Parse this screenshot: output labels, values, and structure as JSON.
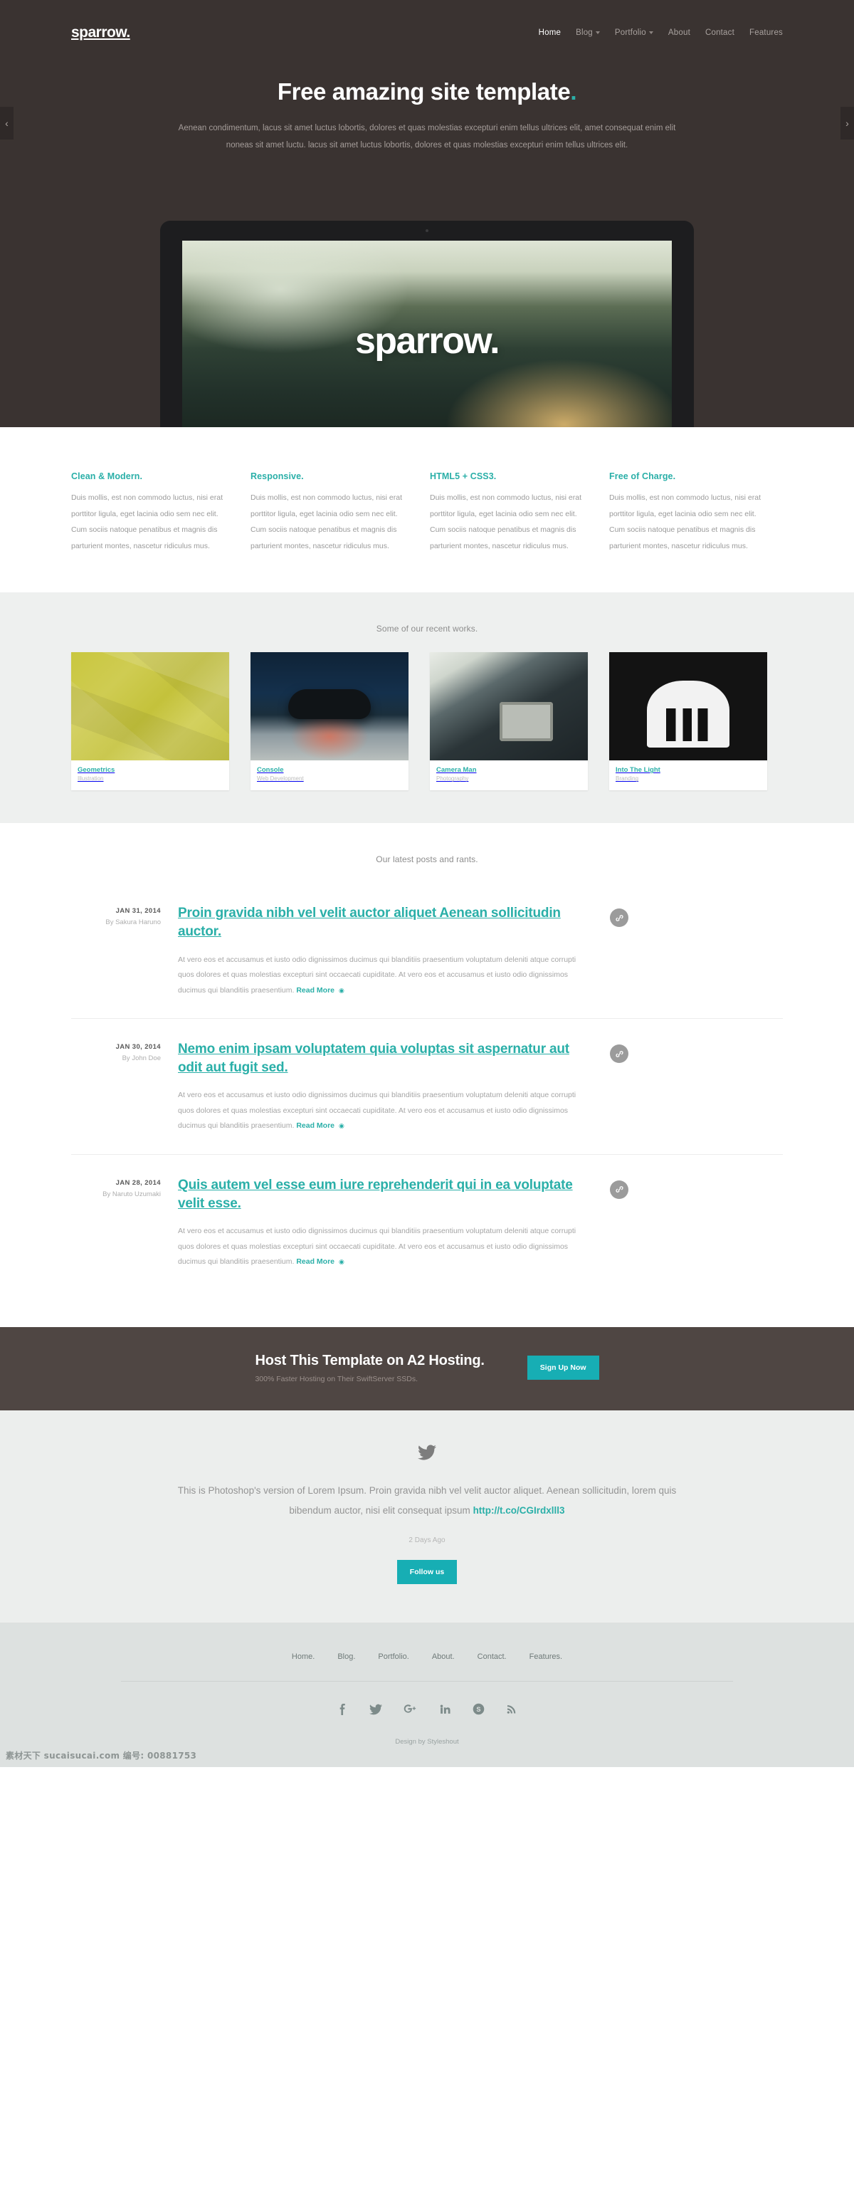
{
  "brand": {
    "logo": "sparrow.",
    "accent": "#2aafa8",
    "dark": "#3a3331",
    "cta_bg": "#4f4643",
    "btn": "#17aeb4"
  },
  "nav": {
    "items": [
      {
        "label": "Home",
        "caret": false,
        "active": true
      },
      {
        "label": "Blog",
        "caret": true,
        "active": false
      },
      {
        "label": "Portfolio",
        "caret": true,
        "active": false
      },
      {
        "label": "About",
        "caret": false,
        "active": false
      },
      {
        "label": "Contact",
        "caret": false,
        "active": false
      },
      {
        "label": "Features",
        "caret": false,
        "active": false
      }
    ]
  },
  "hero": {
    "title": "Free amazing site template",
    "title_dot": ".",
    "subtitle": "Aenean condimentum, lacus sit amet luctus lobortis, dolores et quas molestias excepturi enim tellus ultrices elit, amet consequat enim elit noneas sit amet luctu. lacus sit amet luctus lobortis, dolores et quas molestias excepturi enim tellus ultrices elit.",
    "slider_prev": "‹",
    "slider_next": "›",
    "screen_word": "sparrow."
  },
  "features": [
    {
      "title": "Clean & Modern.",
      "body": "Duis mollis, est non commodo luctus, nisi erat porttitor ligula, eget lacinia odio sem nec elit. Cum sociis natoque penatibus et magnis dis parturient montes, nascetur ridiculus mus."
    },
    {
      "title": "Responsive.",
      "body": "Duis mollis, est non commodo luctus, nisi erat porttitor ligula, eget lacinia odio sem nec elit. Cum sociis natoque penatibus et magnis dis parturient montes, nascetur ridiculus mus."
    },
    {
      "title": "HTML5 + CSS3.",
      "body": "Duis mollis, est non commodo luctus, nisi erat porttitor ligula, eget lacinia odio sem nec elit. Cum sociis natoque penatibus et magnis dis parturient montes, nascetur ridiculus mus."
    },
    {
      "title": "Free of Charge.",
      "body": "Duis mollis, est non commodo luctus, nisi erat porttitor ligula, eget lacinia odio sem nec elit. Cum sociis natoque penatibus et magnis dis parturient montes, nascetur ridiculus mus."
    }
  ],
  "portfolio": {
    "heading": "Some of our recent works.",
    "items": [
      {
        "title": "Geometrics",
        "category": "Illustration"
      },
      {
        "title": "Console",
        "category": "Web Development"
      },
      {
        "title": "Camera Man",
        "category": "Photography"
      },
      {
        "title": "Into The Light",
        "category": "Branding"
      }
    ]
  },
  "blog": {
    "heading": "Our latest posts and rants.",
    "read_more": "Read More",
    "posts": [
      {
        "date": "JAN 31, 2014",
        "author": "By Sakura Haruno",
        "title": "Proin gravida nibh vel velit auctor aliquet Aenean sollicitudin auctor.",
        "excerpt": "At vero eos et accusamus et iusto odio dignissimos ducimus qui blanditiis praesentium voluptatum deleniti atque corrupti quos dolores et quas molestias excepturi sint occaecati cupiditate. At vero eos et accusamus et iusto odio dignissimos ducimus qui blanditiis praesentium."
      },
      {
        "date": "JAN 30, 2014",
        "author": "By John Doe",
        "title": "Nemo enim ipsam voluptatem quia voluptas sit aspernatur aut odit aut fugit sed.",
        "excerpt": "At vero eos et accusamus et iusto odio dignissimos ducimus qui blanditiis praesentium voluptatum deleniti atque corrupti quos dolores et quas molestias excepturi sint occaecati cupiditate. At vero eos et accusamus et iusto odio dignissimos ducimus qui blanditiis praesentium."
      },
      {
        "date": "JAN 28, 2014",
        "author": "By Naruto Uzumaki",
        "title": "Quis autem vel esse eum iure reprehenderit qui in ea voluptate velit esse.",
        "excerpt": "At vero eos et accusamus et iusto odio dignissimos ducimus qui blanditiis praesentium voluptatum deleniti atque corrupti quos dolores et quas molestias excepturi sint occaecati cupiditate. At vero eos et accusamus et iusto odio dignissimos ducimus qui blanditiis praesentium."
      }
    ]
  },
  "cta": {
    "title": "Host This Template on A2 Hosting.",
    "subtitle": "300% Faster Hosting on Their SwiftServer SSDs.",
    "button": "Sign Up Now"
  },
  "twitter": {
    "text_before": "This is Photoshop's version of Lorem Ipsum. Proin gravida nibh vel velit auctor aliquet. Aenean sollicitudin, lorem quis bibendum auctor, nisi elit consequat ipsum ",
    "link": "http://t.co/CGIrdxlll3",
    "time": "2 Days Ago",
    "button": "Follow us"
  },
  "footer": {
    "links": [
      "Home.",
      "Blog.",
      "Portfolio.",
      "About.",
      "Contact.",
      "Features."
    ],
    "socials": [
      "facebook-icon",
      "twitter-icon",
      "googleplus-icon",
      "linkedin-icon",
      "skype-icon",
      "rss-icon"
    ],
    "credit": "Design by Styleshout"
  },
  "watermark": "素材天下 sucaisucai.com  编号: 00881753"
}
